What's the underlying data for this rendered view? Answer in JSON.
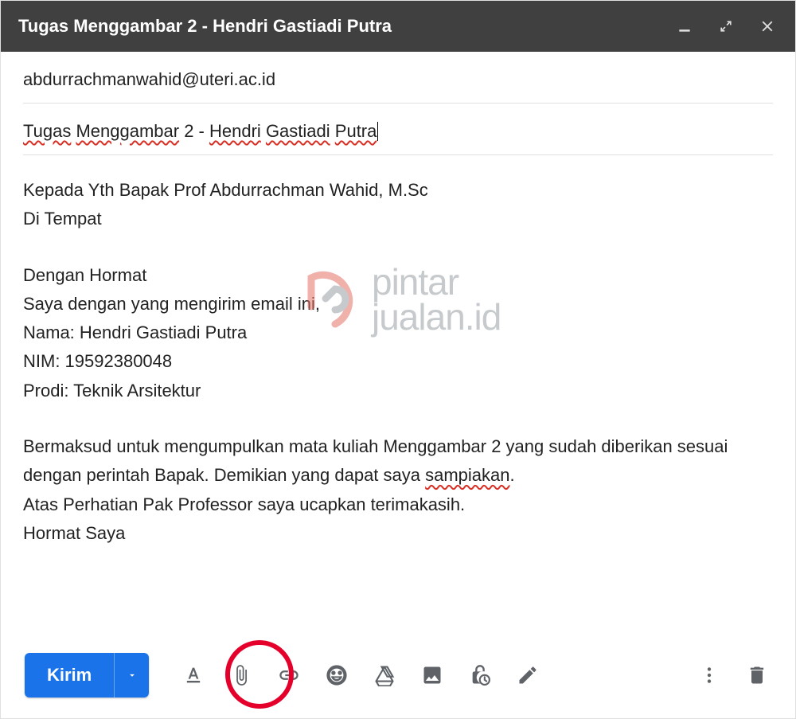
{
  "titlebar": {
    "title": "Tugas Menggambar 2 - Hendri Gastiadi Putra"
  },
  "fields": {
    "to": "abdurrachmanwahid@uteri.ac.id",
    "subject_parts": {
      "p0": "Tugas",
      "s0": " ",
      "p1": "Menggambar",
      "s1": " 2 - ",
      "p2": "Hendri",
      "s2": " ",
      "p3": "Gastiadi",
      "s3": " ",
      "p4": "Putra"
    }
  },
  "body": {
    "l1": "Kepada Yth Bapak Prof Abdurrachman Wahid, M.Sc",
    "l2": "Di Tempat",
    "l3": "Dengan Hormat",
    "l4": "Saya dengan yang mengirim email ini,",
    "l5": "Nama: Hendri Gastiadi Putra",
    "l6": "NIM: 19592380048",
    "l7": "Prodi: Teknik Arsitektur",
    "l8a": "Bermaksud untuk mengumpulkan mata kuliah Menggambar 2 yang sudah diberikan sesuai dengan perintah Bapak. Demikian yang dapat saya ",
    "l8b": "sampiakan",
    "l8c": ".",
    "l9": "Atas Perhatian Pak Professor saya ucapkan terimakasih.",
    "l10": "Hormat Saya"
  },
  "toolbar": {
    "send": "Kirim"
  },
  "watermark": {
    "line1": "pintar",
    "line2": "jualan.id"
  },
  "icons": {
    "minimize": "minimize",
    "expand": "expand",
    "close": "close",
    "format": "format-text",
    "attach": "attach-file",
    "link": "insert-link",
    "emoji": "emoji",
    "drive": "drive",
    "photo": "insert-photo",
    "confidential": "confidential-lock",
    "pen": "signature-pen",
    "more": "more-options",
    "trash": "discard-draft"
  }
}
